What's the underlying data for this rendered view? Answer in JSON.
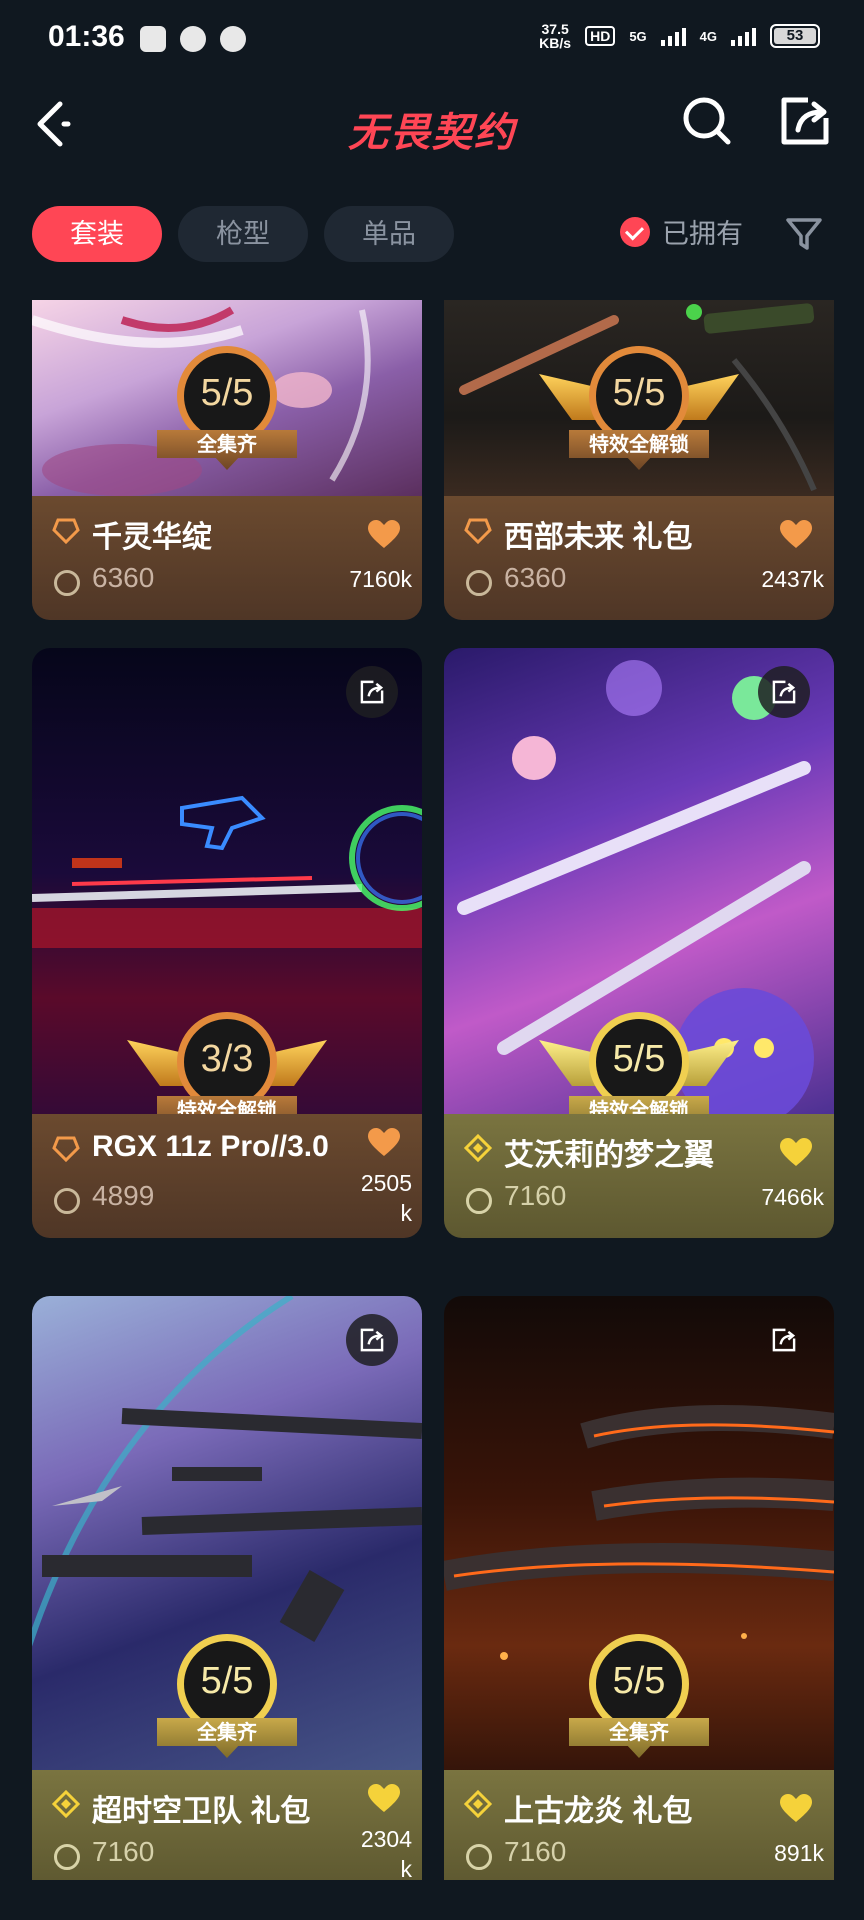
{
  "status_bar": {
    "time": "01:36",
    "speed_value": "37.5",
    "speed_unit": "KB/s",
    "hd_tag": "HD",
    "net1": "5G",
    "net2": "4G",
    "battery": "53"
  },
  "header": {
    "logo": "无畏契约",
    "back_icon": "chevron-left-icon",
    "search_icon": "search-icon",
    "share_icon": "share-icon"
  },
  "tabs": [
    {
      "label": "套装",
      "active": true
    },
    {
      "label": "枪型",
      "active": false
    },
    {
      "label": "单品",
      "active": false
    }
  ],
  "owned_filter": {
    "label": "已拥有",
    "checked": true
  },
  "colors": {
    "accent": "#ff4655",
    "background": "#101820",
    "bronze_footer": "#5c3f2b",
    "gold_footer": "#6b6538",
    "bronze_heart": "#f39a4a",
    "gold_heart": "#f5d23a"
  },
  "cards": [
    {
      "name": "千灵华绽",
      "price": "6360",
      "likes": "7160k",
      "badge": "5/5",
      "badge_label": "全集齐",
      "tier": "bronze",
      "owned_progress": "5/5"
    },
    {
      "name": "西部未来 礼包",
      "price": "6360",
      "likes": "2437k",
      "badge": "5/5",
      "badge_label": "特效全解锁",
      "tier": "bronze",
      "owned_progress": "5/5"
    },
    {
      "name": "RGX 11z Pro//3.0",
      "price": "4899",
      "likes": "2505k",
      "badge": "3/3",
      "badge_label": "特效全解锁",
      "tier": "bronze",
      "owned_progress": "3/3"
    },
    {
      "name": "艾沃莉的梦之翼",
      "price": "7160",
      "likes": "7466k",
      "badge": "5/5",
      "badge_label": "特效全解锁",
      "tier": "gold",
      "owned_progress": "5/5"
    },
    {
      "name": "超时空卫队 礼包",
      "price": "7160",
      "likes": "2304k",
      "badge": "5/5",
      "badge_label": "全集齐",
      "tier": "gold",
      "owned_progress": "5/5"
    },
    {
      "name": "上古龙炎 礼包",
      "price": "7160",
      "likes": "891k",
      "badge": "5/5",
      "badge_label": "全集齐",
      "tier": "gold",
      "owned_progress": "5/5"
    }
  ]
}
